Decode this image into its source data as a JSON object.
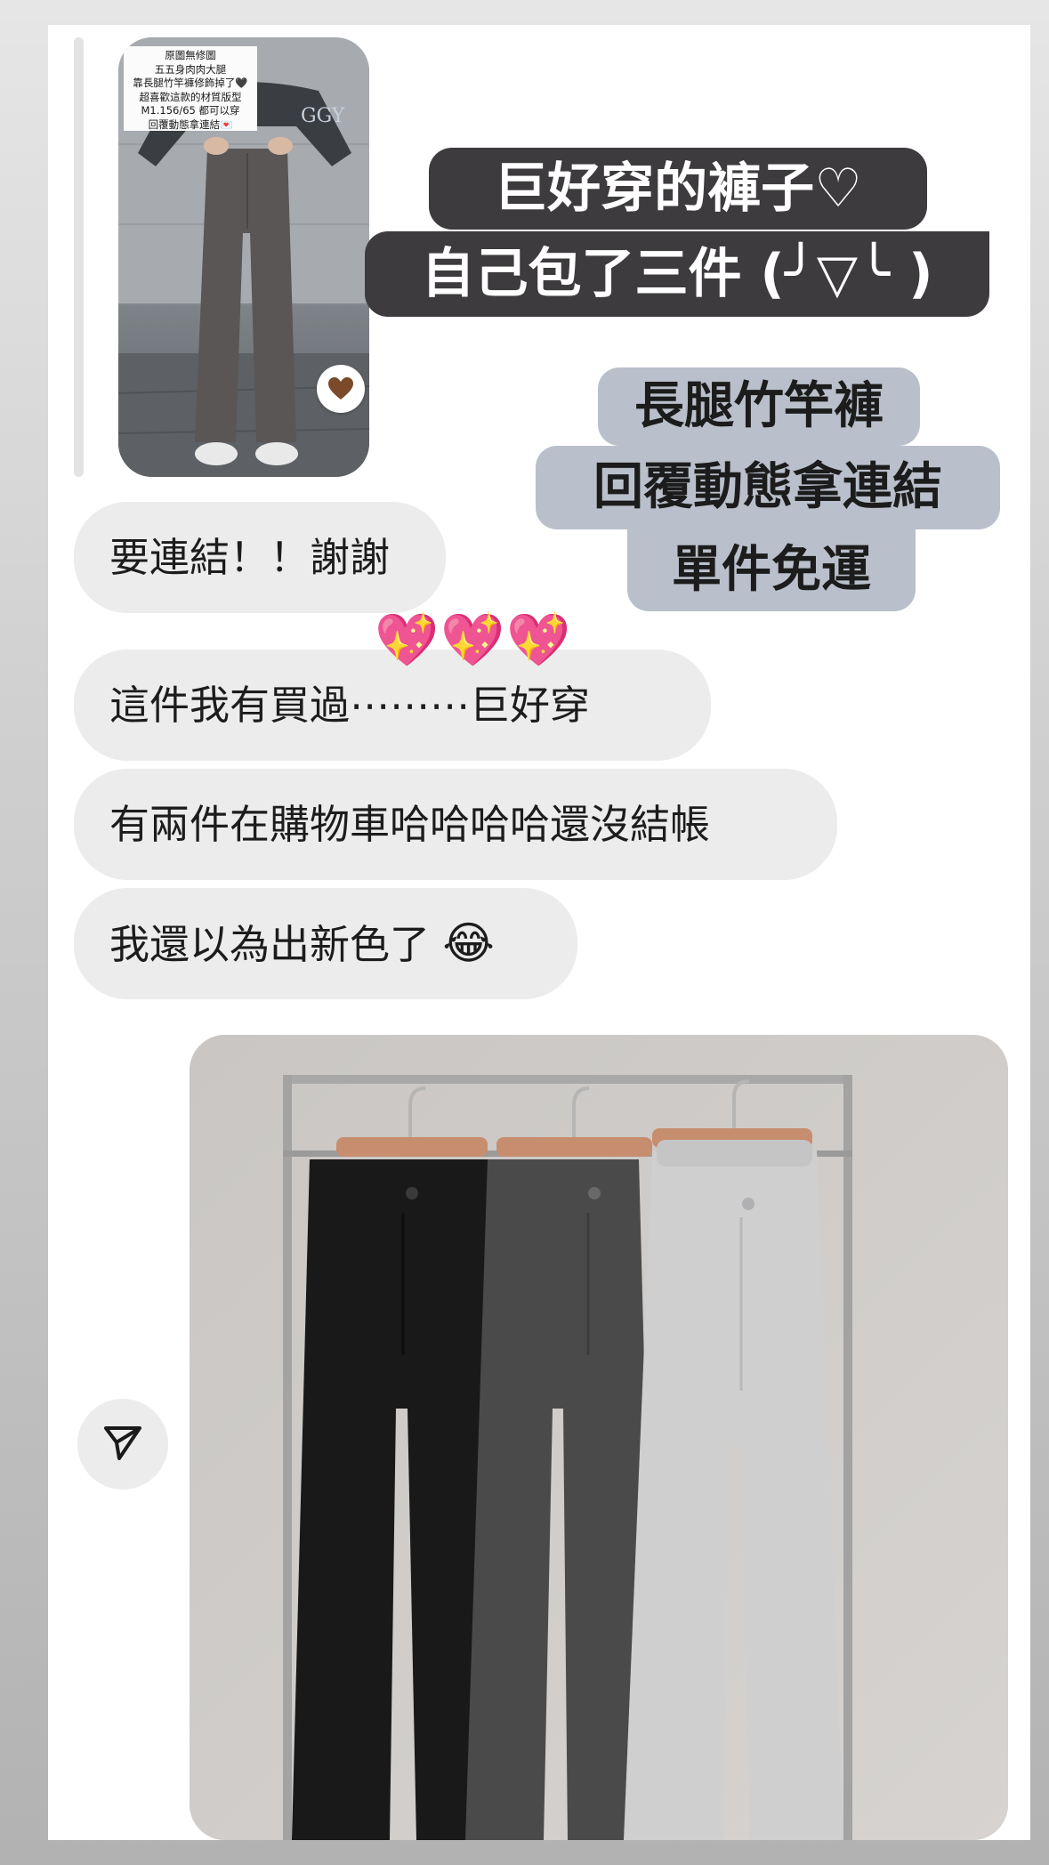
{
  "story_reply": {
    "note_lines": [
      "原圖無修圖",
      "五五身肉肉大腿",
      "靠長腿竹竿褲修飾掉了🖤",
      "超喜歡這款的材質版型",
      "M1.156/65 都可以穿",
      "回覆動態拿連結💌"
    ],
    "heart_icon": "brown-heart-icon"
  },
  "stickers": {
    "dark": {
      "lines": [
        "巨好穿的褲子♡",
        "自己包了三件 (╯▽╰ )"
      ],
      "bg": "#3e3b3e"
    },
    "blue": {
      "lines": [
        "長腿竹竿褲",
        "回覆動態拿連結",
        "單件免運"
      ],
      "bg": "#b9c0cb"
    }
  },
  "messages": [
    {
      "text": "要連結！！謝謝"
    },
    {
      "text": "這件我有買過⋯⋯⋯巨好穿",
      "reaction": "💖💖💖"
    },
    {
      "text": "有兩件在購物車哈哈哈哈還沒結帳"
    },
    {
      "text": "我還以為出新色了",
      "emoji": "😂"
    }
  ],
  "product_image": {
    "subject": "pants-on-hanger-rack",
    "colors": [
      "#191919",
      "#4b4a4b",
      "#cfcfd0"
    ]
  },
  "share_button": {
    "icon": "send-icon"
  }
}
